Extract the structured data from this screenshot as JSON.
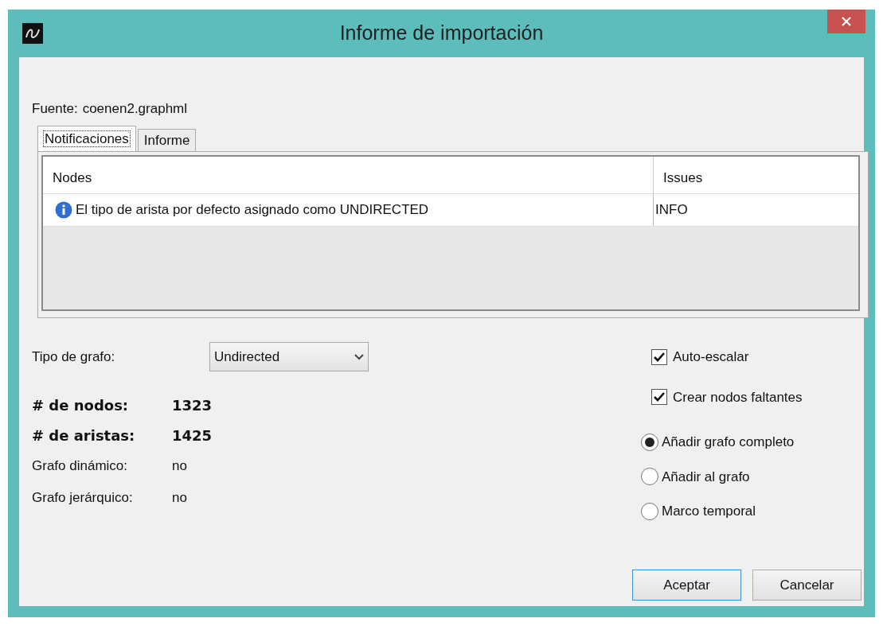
{
  "window": {
    "title": "Informe de importación"
  },
  "source": {
    "label": "Fuente:",
    "value": "coenen2.graphml"
  },
  "tabs": [
    {
      "label": "Notificaciones",
      "selected": true
    },
    {
      "label": "Informe",
      "selected": false
    }
  ],
  "table": {
    "columns": [
      "Nodes",
      "Issues"
    ],
    "rows": [
      {
        "kind": "info",
        "cells": [
          "El tipo de arista por defecto asignado como UNDIRECTED",
          "INFO"
        ]
      }
    ]
  },
  "graph_type": {
    "label": "Tipo de grafo:",
    "value": "Undirected"
  },
  "stats": [
    {
      "label": "# de nodos:",
      "value": "1323",
      "kind": "bold"
    },
    {
      "label": "# de aristas:",
      "value": "1425",
      "kind": "bold"
    },
    {
      "label": "Grafo dinámico:",
      "value": "no",
      "kind": "plain"
    },
    {
      "label": "Grafo jerárquico:",
      "value": "no",
      "kind": "plain"
    }
  ],
  "checkboxes": [
    {
      "label": "Auto-escalar",
      "checked": true
    },
    {
      "label": "Crear nodos faltantes",
      "checked": true
    }
  ],
  "radios": [
    {
      "label": "Añadir grafo completo",
      "selected": true
    },
    {
      "label": "Añadir al grafo",
      "selected": false
    },
    {
      "label": "Marco temporal",
      "selected": false
    }
  ],
  "buttons": [
    {
      "label": "Aceptar",
      "focused": true
    },
    {
      "label": "Cancelar",
      "focused": false
    }
  ]
}
